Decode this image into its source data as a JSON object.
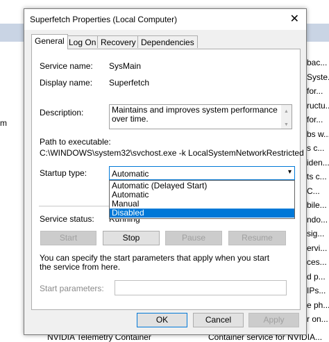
{
  "background": {
    "left_fragment": "m",
    "right_rows": [
      "bac...",
      "Syste...",
      "for...",
      "ructu...",
      "for...",
      "bs w...",
      "s c...",
      "iden...",
      "ts c...",
      "C...",
      "bile...",
      "ndo...",
      "sig...",
      "ervi...",
      "ces...",
      "d p...",
      "IPs...",
      "e ph...",
      "r on..."
    ],
    "bottom_left": "NVIDIA Telemetry Container",
    "bottom_right": "Container service for NVIDIA..."
  },
  "dialog": {
    "title": "Superfetch Properties (Local Computer)",
    "close_glyph": "✕",
    "tabs": [
      {
        "label": "General",
        "active": true
      },
      {
        "label": "Log On",
        "active": false
      },
      {
        "label": "Recovery",
        "active": false
      },
      {
        "label": "Dependencies",
        "active": false
      }
    ],
    "service_name_label": "Service name:",
    "service_name_value": "SysMain",
    "display_name_label": "Display name:",
    "display_name_value": "Superfetch",
    "description_label": "Description:",
    "description_value": "Maintains and improves system performance over time.",
    "path_label": "Path to executable:",
    "path_value": "C:\\WINDOWS\\system32\\svchost.exe -k LocalSystemNetworkRestricted",
    "startup_type_label": "Startup type:",
    "startup_type_value": "Automatic",
    "startup_options": [
      {
        "label": "Automatic (Delayed Start)",
        "selected": false
      },
      {
        "label": "Automatic",
        "selected": false
      },
      {
        "label": "Manual",
        "selected": false
      },
      {
        "label": "Disabled",
        "selected": true
      }
    ],
    "service_status_label": "Service status:",
    "service_status_value": "Running",
    "buttons": {
      "start": "Start",
      "stop": "Stop",
      "pause": "Pause",
      "resume": "Resume"
    },
    "help_text": "You can specify the start parameters that apply when you start the service from here.",
    "start_params_label": "Start parameters:",
    "start_params_value": "",
    "footer": {
      "ok": "OK",
      "cancel": "Cancel",
      "apply": "Apply"
    }
  }
}
